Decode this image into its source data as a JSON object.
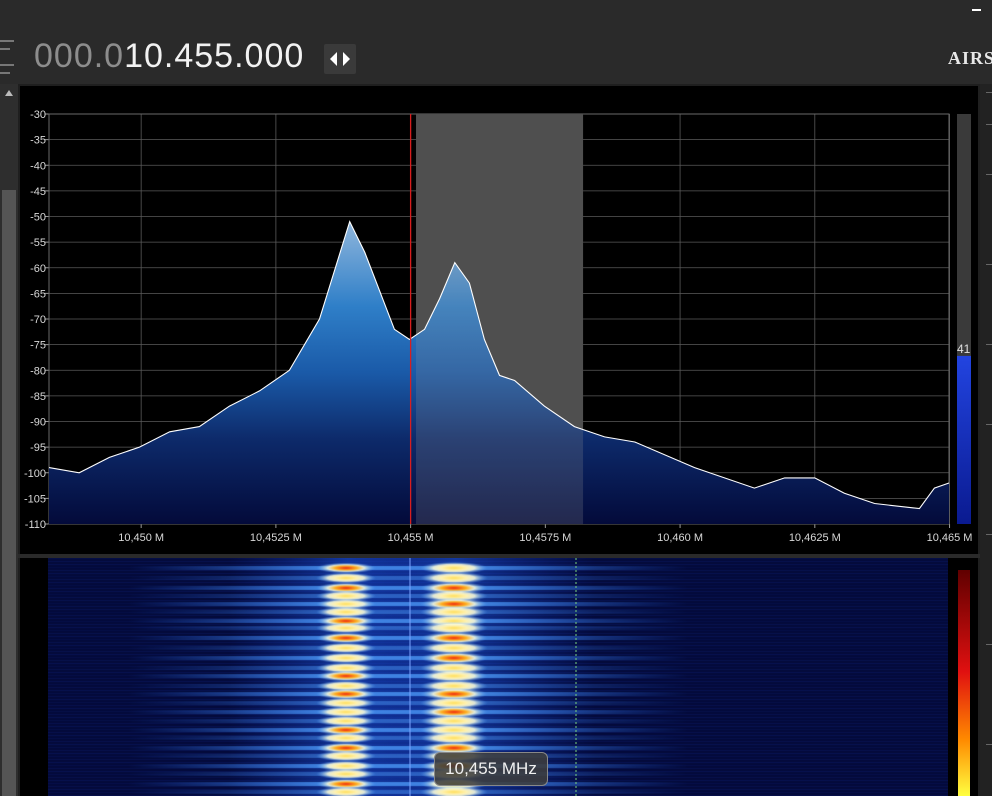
{
  "header": {
    "frequency_dim": "000.0",
    "frequency_bright": "10.455.000",
    "logo": "AIRS"
  },
  "spectrum": {
    "level_value": "41",
    "y_labels": [
      "-30",
      "-35",
      "-40",
      "-45",
      "-50",
      "-55",
      "-60",
      "-65",
      "-70",
      "-75",
      "-80",
      "-85",
      "-90",
      "-95",
      "-100",
      "-105",
      "-110"
    ],
    "x_labels": [
      "10,450 M",
      "10,4525 M",
      "10,455 M",
      "10,4575 M",
      "10,460 M",
      "10,4625 M",
      "10,465 M"
    ],
    "colors": {
      "background": "#000000",
      "grid": "#5a5a5a",
      "center_line": "#d81e1e",
      "filter_band": "#3c3c3c",
      "trace": "#ffffff",
      "level_bar": "#1030c8"
    }
  },
  "chart_data": {
    "type": "area",
    "title": "",
    "xlabel": "",
    "ylabel": "",
    "xlim": [
      10.44829,
      10.46499
    ],
    "ylim": [
      -110,
      -30
    ],
    "x_unit": "MHz",
    "y_unit": "dB",
    "center_frequency": 10.455,
    "filter_band": [
      10.4551,
      10.4582
    ],
    "x": [
      10.44829,
      10.44885,
      10.44941,
      10.44997,
      10.45053,
      10.45108,
      10.45164,
      10.4522,
      10.45275,
      10.45331,
      10.45387,
      10.45415,
      10.4547,
      10.45498,
      10.45526,
      10.45554,
      10.45582,
      10.45609,
      10.45637,
      10.45665,
      10.45693,
      10.45748,
      10.45804,
      10.4586,
      10.45916,
      10.46027,
      10.46138,
      10.46194,
      10.4625,
      10.46305,
      10.46361,
      10.46444,
      10.46472,
      10.46499
    ],
    "y": [
      -99,
      -100,
      -97,
      -95,
      -92,
      -91,
      -87,
      -84,
      -80,
      -70,
      -51,
      -57,
      -72,
      -74,
      -72,
      -66,
      -59,
      -63,
      -74,
      -81,
      -82,
      -87,
      -91,
      -93,
      -94,
      -99,
      -103,
      -101,
      -101,
      -104,
      -106,
      -107,
      -103,
      -102
    ]
  },
  "waterfall": {
    "tooltip": "10,455 MHz",
    "colors": {
      "background": "#030a3a",
      "mid": "#1a6cf0",
      "high": "#f5f0c0",
      "peak": "#e02010"
    }
  }
}
